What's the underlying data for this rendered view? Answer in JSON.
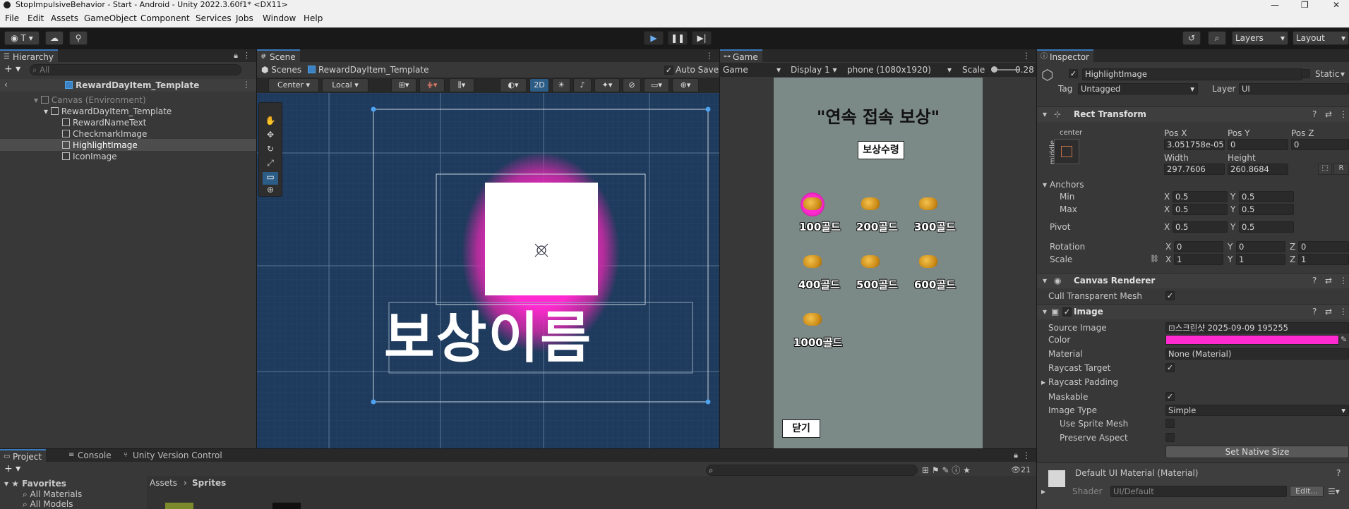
{
  "window": {
    "title": "StopImpulsiveBehavior - Start - Android - Unity 2022.3.60f1* <DX11>",
    "controls": [
      "—",
      "❐",
      "✕"
    ]
  },
  "menu": [
    "File",
    "Edit",
    "Assets",
    "GameObject",
    "Component",
    "Services",
    "Jobs",
    "Window",
    "Help"
  ],
  "toolbar": {
    "account_label": "T",
    "layers_label": "Layers",
    "layout_label": "Layout"
  },
  "hierarchy": {
    "tab": "Hierarchy",
    "search_placeholder": "All",
    "prefab_title": "RewardDayItem_Template",
    "items": [
      {
        "label": "Canvas (Environment)",
        "depth": 0
      },
      {
        "label": "RewardDayItem_Template",
        "depth": 1
      },
      {
        "label": "RewardNameText",
        "depth": 2
      },
      {
        "label": "CheckmarkImage",
        "depth": 2
      },
      {
        "label": "HighlightImage",
        "depth": 2
      },
      {
        "label": "IconImage",
        "depth": 2
      }
    ]
  },
  "scene": {
    "tab": "Scene",
    "breadcrumb_scenes": "Scenes",
    "breadcrumb_prefab": "RewardDayItem_Template",
    "autosave": "Auto Save",
    "pivot_mode": "Center",
    "space_mode": "Local",
    "mode_2d": "2D",
    "preview_text": "보상이름"
  },
  "game": {
    "tab": "Game",
    "view_dropdown": "Game",
    "display": "Display 1",
    "resolution": "phone (1080x1920)",
    "scale_label": "Scale",
    "scale_value": "0.28",
    "title": "\"연속 접속 보상\"",
    "claim_button": "보상수령",
    "rewards": [
      "100골드",
      "200골드",
      "300골드",
      "400골드",
      "500골드",
      "600골드",
      "1000골드"
    ],
    "close_button": "닫기"
  },
  "inspector": {
    "tab": "Inspector",
    "object_name": "HighlightImage",
    "static_label": "Static",
    "tag_label": "Tag",
    "tag_value": "Untagged",
    "layer_label": "Layer",
    "layer_value": "UI",
    "rect_transform": {
      "header": "Rect Transform",
      "anchor_h": "center",
      "anchor_v": "middle",
      "pos_x_label": "Pos X",
      "pos_y_label": "Pos Y",
      "pos_z_label": "Pos Z",
      "pos_x": "3.051758e-05",
      "pos_y": "0",
      "pos_z": "0",
      "width_label": "Width",
      "height_label": "Height",
      "width": "297.7606",
      "height": "260.8684",
      "anchors_label": "Anchors",
      "min_label": "Min",
      "max_label": "Max",
      "min_x": "0.5",
      "min_y": "0.5",
      "max_x": "0.5",
      "max_y": "0.5",
      "pivot_label": "Pivot",
      "pivot_x": "0.5",
      "pivot_y": "0.5",
      "rotation_label": "Rotation",
      "rot_x": "0",
      "rot_y": "0",
      "rot_z": "0",
      "scale_label": "Scale",
      "scale_x": "1",
      "scale_y": "1",
      "scale_z": "1",
      "axis_x": "X",
      "axis_y": "Y",
      "axis_z": "Z",
      "r_button": "R"
    },
    "canvas_renderer": {
      "header": "Canvas Renderer",
      "cull_label": "Cull Transparent Mesh"
    },
    "image": {
      "header": "Image",
      "source_label": "Source Image",
      "source_value": "스크린샷 2025-09-09 195255",
      "color_label": "Color",
      "color_value": "#ff2bd0",
      "material_label": "Material",
      "material_value": "None (Material)",
      "raycast_label": "Raycast Target",
      "padding_label": "Raycast Padding",
      "maskable_label": "Maskable",
      "type_label": "Image Type",
      "type_value": "Simple",
      "sprite_mesh_label": "Use Sprite Mesh",
      "preserve_label": "Preserve Aspect",
      "native_button": "Set Native Size"
    },
    "material": {
      "name": "Default UI Material (Material)",
      "shader_label": "Shader",
      "shader_value": "UI/Default",
      "edit_button": "Edit..."
    }
  },
  "project": {
    "tabs": [
      "Project",
      "Console",
      "Unity Version Control"
    ],
    "favorites": "Favorites",
    "fav_items": [
      "All Materials",
      "All Models"
    ],
    "path": [
      "Assets",
      "Sprites"
    ],
    "count": "21"
  },
  "colors": {
    "accent": "#3a79bb",
    "highlight_pink": "#ff2bd0",
    "scene_bg": "#1e3a5c",
    "game_bg": "#7c8a87"
  }
}
